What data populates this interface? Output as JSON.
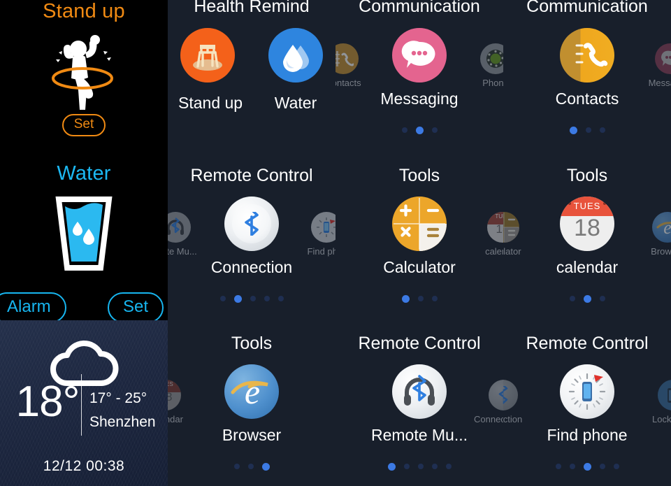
{
  "sidebar": {
    "standup": {
      "title": "Stand up",
      "icon": "standup-figure-icon",
      "button": "Set",
      "accent": "#f08a13"
    },
    "water": {
      "title": "Water",
      "icon": "water-glass-icon",
      "alarm_button": "Alarm",
      "set_button": "Set",
      "accent": "#17b6f0"
    },
    "weather": {
      "icon": "cloud-icon",
      "temperature": "18°",
      "range": "17° - 25°",
      "city": "Shenzhen",
      "datetime": "12/12  00:38"
    }
  },
  "grid": {
    "panels": [
      {
        "title": "Health Remind",
        "layout": "two-up",
        "items": [
          {
            "label": "Stand up",
            "icon": "chair-standup-icon"
          },
          {
            "label": "Water",
            "icon": "water-drop-icon"
          }
        ],
        "dots": {
          "count": 0,
          "active": -1
        }
      },
      {
        "title": "Communication",
        "layout": "carousel",
        "left": {
          "label": "Contacts",
          "icon": "contacts-book-icon"
        },
        "center": {
          "label": "Messaging",
          "icon": "messaging-bubble-icon"
        },
        "right": {
          "label": "Phone",
          "icon": "rotary-phone-icon"
        },
        "dots": {
          "count": 3,
          "active": 1
        }
      },
      {
        "title": "Communication",
        "layout": "carousel",
        "left": null,
        "center": {
          "label": "Contacts",
          "icon": "contacts-book-icon"
        },
        "right": {
          "label": "Messaging",
          "icon": "messaging-bubble-icon"
        },
        "dots": {
          "count": 3,
          "active": 0
        }
      },
      {
        "title": "Remote Control",
        "layout": "carousel",
        "left": {
          "label": "mote Mu...",
          "icon": "remote-music-headphone-icon"
        },
        "center": {
          "label": "Connection",
          "icon": "bluetooth-connection-icon"
        },
        "right": {
          "label": "Find phor",
          "icon": "find-phone-icon"
        },
        "dots": {
          "count": 5,
          "active": 1
        }
      },
      {
        "title": "Tools",
        "layout": "carousel",
        "left": null,
        "center": {
          "label": "Calculator",
          "icon": "calculator-icon"
        },
        "right": {
          "label": "calendar",
          "icon": "calendar-icon"
        },
        "right2": {
          "label": "alculator",
          "icon": "calculator-icon"
        },
        "dots": {
          "count": 3,
          "active": 0
        }
      },
      {
        "title": "Tools",
        "layout": "carousel",
        "left": {
          "label": "alculator",
          "icon": "calculator-icon"
        },
        "center": {
          "label": "calendar",
          "icon": "calendar-icon"
        },
        "right": {
          "label": "Browser",
          "icon": "browser-e-icon"
        },
        "dots": {
          "count": 3,
          "active": 1
        }
      },
      {
        "title": "Tools",
        "layout": "carousel",
        "left": {
          "label": "calendar",
          "icon": "calendar-icon"
        },
        "center": {
          "label": "Browser",
          "icon": "browser-e-icon"
        },
        "right": null,
        "dots": {
          "count": 3,
          "active": 2
        }
      },
      {
        "title": "Remote Control",
        "layout": "carousel",
        "left": null,
        "center": {
          "label": "Remote Mu...",
          "icon": "remote-music-headphone-icon"
        },
        "right": {
          "label": "Connectionnection",
          "icon": "bluetooth-connection-icon"
        },
        "dots": {
          "count": 5,
          "active": 0
        }
      },
      {
        "title": "Remote Control",
        "layout": "carousel",
        "left": {
          "label": "onnection",
          "icon": "bluetooth-connection-icon"
        },
        "center": {
          "label": "Find phone",
          "icon": "find-phone-icon"
        },
        "right": {
          "label": "Lock phon",
          "icon": "lock-phone-icon"
        },
        "dots": {
          "count": 5,
          "active": 2
        }
      }
    ]
  },
  "colors": {
    "sidebar_bg": "#000000",
    "grid_bg": "#181f2b",
    "dot_active": "#3c7ae4",
    "dot_inactive": "#1f2f52",
    "orange_accent": "#f08a13",
    "cyan_accent": "#17b6f0"
  }
}
